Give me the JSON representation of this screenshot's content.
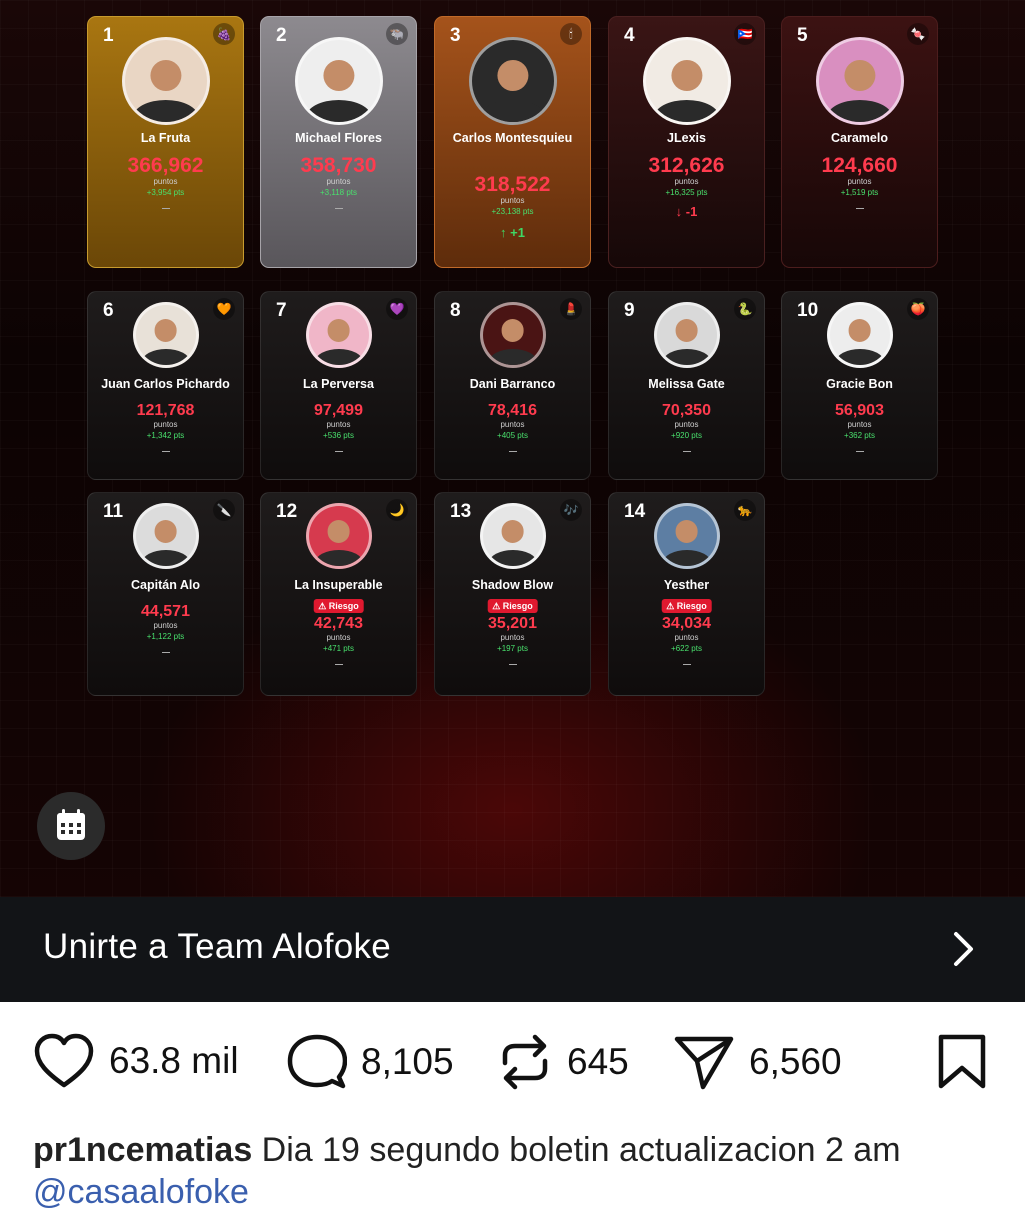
{
  "contestants": [
    {
      "rank": "1",
      "name": "La Fruta",
      "points": "366,962",
      "points_label": "puntos",
      "delta": "+3,954 pts",
      "movement": "—",
      "emoji": "🍇",
      "tier": "c1",
      "avatar_bg": "#e9d6c4"
    },
    {
      "rank": "2",
      "name": "Michael Flores",
      "points": "358,730",
      "points_label": "puntos",
      "delta": "+3,118 pts",
      "movement": "—",
      "emoji": "🐃",
      "tier": "c2",
      "avatar_bg": "#eeeeee"
    },
    {
      "rank": "3",
      "name": "Carlos Montesquieu",
      "points": "318,522",
      "points_label": "puntos",
      "delta": "+23,138 pts",
      "movement": "↑ +1",
      "movement_dir": "up",
      "emoji": "🕯",
      "tier": "c3",
      "avatar_bg": "#2a2a2a"
    },
    {
      "rank": "4",
      "name": "JLexis",
      "points": "312,626",
      "points_label": "puntos",
      "delta": "+16,325 pts",
      "movement": "↓ -1",
      "movement_dir": "down",
      "emoji": "🇵🇷",
      "tier": "c4",
      "avatar_bg": "#f1ebe4"
    },
    {
      "rank": "5",
      "name": "Caramelo",
      "points": "124,660",
      "points_label": "puntos",
      "delta": "+1,519 pts",
      "movement": "—",
      "emoji": "🍬",
      "tier": "c5",
      "avatar_bg": "#d98fc0"
    },
    {
      "rank": "6",
      "name": "Juan Carlos Pichardo",
      "points": "121,768",
      "points_label": "puntos",
      "delta": "+1,342 pts",
      "movement": "—",
      "emoji": "🧡",
      "avatar_bg": "#e8e1d8"
    },
    {
      "rank": "7",
      "name": "La Perversa",
      "points": "97,499",
      "points_label": "puntos",
      "delta": "+536 pts",
      "movement": "—",
      "emoji": "💜",
      "avatar_bg": "#f0b6c8"
    },
    {
      "rank": "8",
      "name": "Dani Barranco",
      "points": "78,416",
      "points_label": "puntos",
      "delta": "+405 pts",
      "movement": "—",
      "emoji": "💄",
      "avatar_bg": "#4a1414"
    },
    {
      "rank": "9",
      "name": "Melissa Gate",
      "points": "70,350",
      "points_label": "puntos",
      "delta": "+920 pts",
      "movement": "—",
      "emoji": "🐍",
      "avatar_bg": "#d9d9d9"
    },
    {
      "rank": "10",
      "name": "Gracie Bon",
      "points": "56,903",
      "points_label": "puntos",
      "delta": "+362 pts",
      "movement": "—",
      "emoji": "🍑",
      "avatar_bg": "#ededed"
    },
    {
      "rank": "11",
      "name": "Capitán Alo",
      "points": "44,571",
      "points_label": "puntos",
      "delta": "+1,122 pts",
      "movement": "—",
      "emoji": "🔪",
      "avatar_bg": "#dcdcdc"
    },
    {
      "rank": "12",
      "name": "La Insuperable",
      "risk": "⚠ Riesgo",
      "points": "42,743",
      "points_label": "puntos",
      "delta": "+471 pts",
      "movement": "—",
      "emoji": "🌙",
      "avatar_bg": "#d63a4e"
    },
    {
      "rank": "13",
      "name": "Shadow Blow",
      "risk": "⚠ Riesgo",
      "points": "35,201",
      "points_label": "puntos",
      "delta": "+197 pts",
      "movement": "—",
      "emoji": "🎶",
      "avatar_bg": "#e6e6e6"
    },
    {
      "rank": "14",
      "name": "Yesther",
      "risk": "⚠ Riesgo",
      "points": "34,034",
      "points_label": "puntos",
      "delta": "+622 pts",
      "movement": "—",
      "emoji": "🐆",
      "avatar_bg": "#5d7ea3"
    }
  ],
  "cta": {
    "label": "Unirte a Team Alofoke",
    "icon": "chevron-right-icon"
  },
  "calendar_button": {
    "icon": "calendar-icon"
  },
  "actions": {
    "likes": "63.8 mil",
    "comments": "8,105",
    "reposts": "645",
    "shares": "6,560"
  },
  "caption": {
    "username": "pr1ncematias",
    "text": " Dia 19 segundo boletin actualizacion 2 am",
    "mention": "@casaalofoke"
  }
}
